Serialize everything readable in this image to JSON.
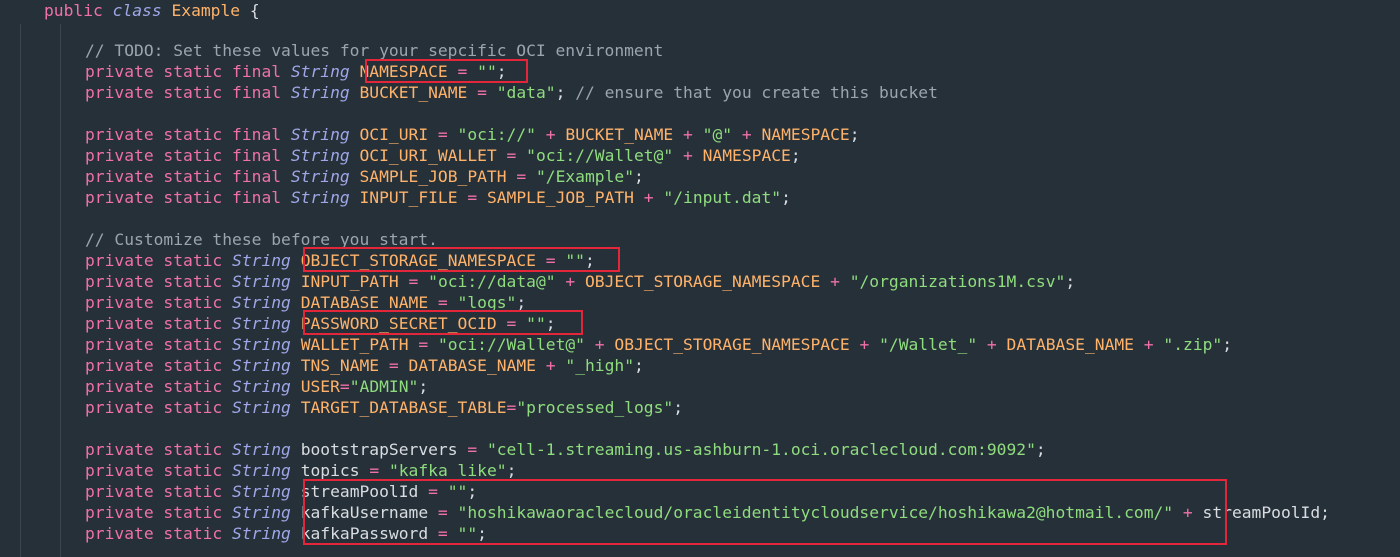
{
  "code": {
    "lines": [
      {
        "kw": "public",
        "mod": "class",
        "name": "Example",
        "brace": "{"
      },
      {
        "comment": "// TODO: Set these values for your sepcific OCI environment"
      },
      {
        "kw": "private static final",
        "type": "String",
        "name": "NAMESPACE",
        "eq": " = ",
        "val": "\"\"",
        "end": ";"
      },
      {
        "kw": "private static final",
        "type": "String",
        "name": "BUCKET_NAME",
        "eq": " = ",
        "val": "\"data\"",
        "end": ";",
        "comment": " // ensure that you create this bucket"
      },
      {
        "kw": "private static final",
        "type": "String",
        "name": "OCI_URI",
        "eq": " = ",
        "s1": "\"oci://\"",
        "p1": " + ",
        "v1": "BUCKET_NAME",
        "p2": " + ",
        "s2": "\"@\"",
        "p3": " + ",
        "v2": "NAMESPACE",
        "end": ";"
      },
      {
        "kw": "private static final",
        "type": "String",
        "name": "OCI_URI_WALLET",
        "eq": " = ",
        "s1": "\"oci://Wallet@\"",
        "p1": " + ",
        "v1": "NAMESPACE",
        "end": ";"
      },
      {
        "kw": "private static final",
        "type": "String",
        "name": "SAMPLE_JOB_PATH",
        "eq": " = ",
        "val": "\"/Example\"",
        "end": ";"
      },
      {
        "kw": "private static final",
        "type": "String",
        "name": "INPUT_FILE",
        "eq": " = ",
        "v1": "SAMPLE_JOB_PATH",
        "p1": " + ",
        "s1": "\"/input.dat\"",
        "end": ";"
      },
      {
        "comment": "// Customize these before you start."
      },
      {
        "kw": "private static",
        "type": "String",
        "name": "OBJECT_STORAGE_NAMESPACE",
        "eq": " = ",
        "val": "\"\"",
        "end": ";"
      },
      {
        "kw": "private static",
        "type": "String",
        "name": "INPUT_PATH",
        "eq": " = ",
        "s1": "\"oci://data@\"",
        "p1": " + ",
        "v1": "OBJECT_STORAGE_NAMESPACE",
        "p2": " + ",
        "s2": "\"/organizations1M.csv\"",
        "end": ";"
      },
      {
        "kw": "private static",
        "type": "String",
        "name": "DATABASE_NAME",
        "eq": " = ",
        "val": "\"logs\"",
        "end": ";"
      },
      {
        "kw": "private static",
        "type": "String",
        "name": "PASSWORD_SECRET_OCID",
        "eq": " = ",
        "val": "\"\"",
        "end": ";"
      },
      {
        "kw": "private static",
        "type": "String",
        "name": "WALLET_PATH",
        "eq": " = ",
        "s1": "\"oci://Wallet@\"",
        "p1": " + ",
        "v1": "OBJECT_STORAGE_NAMESPACE",
        "p2": " + ",
        "s2": "\"/Wallet_\"",
        "p3": " + ",
        "v2": "DATABASE_NAME",
        "p4": " + ",
        "s3": "\".zip\"",
        "end": ";"
      },
      {
        "kw": "private static",
        "type": "String",
        "name": "TNS_NAME",
        "eq": " = ",
        "v1": "DATABASE_NAME",
        "p1": " + ",
        "s1": "\"_high\"",
        "end": ";"
      },
      {
        "kw": "private static",
        "type": "String",
        "name": "USER",
        "eq": "=",
        "val": "\"ADMIN\"",
        "end": ";"
      },
      {
        "kw": "private static",
        "type": "String",
        "name": "TARGET_DATABASE_TABLE",
        "eq": "=",
        "val": "\"processed_logs\"",
        "end": ";"
      },
      {
        "kw": "private static",
        "type": "String",
        "name": "bootstrapServers",
        "eq": " = ",
        "val": "\"cell-1.streaming.us-ashburn-1.oci.oraclecloud.com:9092\"",
        "end": ";"
      },
      {
        "kw": "private static",
        "type": "String",
        "name": "topics",
        "eq": " = ",
        "val": "\"kafka_like\"",
        "end": ";"
      },
      {
        "kw": "private static",
        "type": "String",
        "name": "streamPoolId",
        "eq": " = ",
        "val": "\"\"",
        "end": ";"
      },
      {
        "kw": "private static",
        "type": "String",
        "name": "kafkaUsername",
        "eq": " = ",
        "s1": "\"hoshikawaoraclecloud/oracleidentitycloudservice/hoshikawa2@hotmail.com/\"",
        "p1": " + ",
        "v1": "streamPoolId",
        "end": ";"
      },
      {
        "kw": "private static",
        "type": "String",
        "name": "kafkaPassword",
        "eq": " = ",
        "val": "\"\"",
        "end": ";"
      }
    ]
  },
  "colors": {
    "background": "#263039",
    "keyword": "#f071a6",
    "type": "#9fa7e8",
    "identifier": "#ffb36a",
    "string": "#8fdc7e",
    "comment": "#9aa5ae",
    "highlight_box": "#e3263a"
  }
}
